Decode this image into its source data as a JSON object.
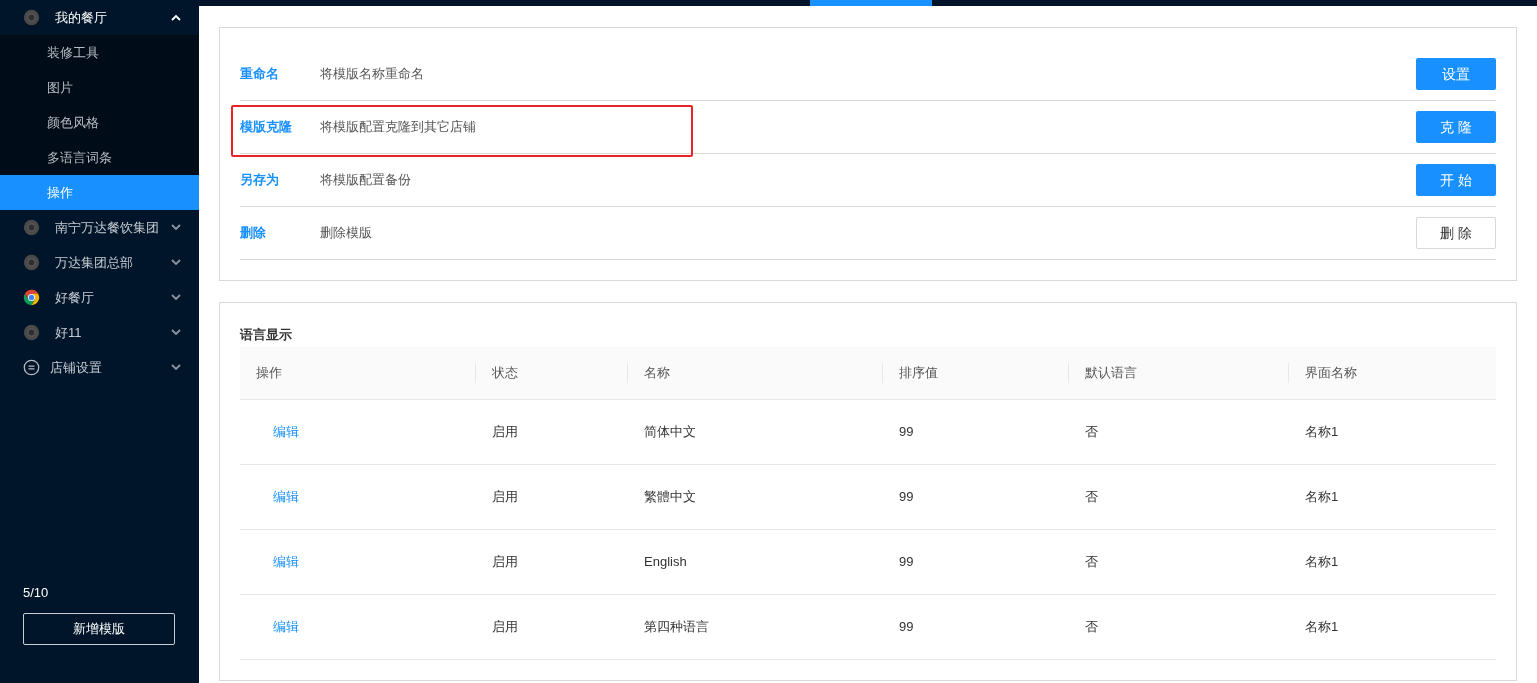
{
  "sidebar": {
    "groups": [
      {
        "label": "我的餐厅",
        "kind": "chrome-grey",
        "expanded": true,
        "children": [
          {
            "label": "装修工具",
            "selected": false
          },
          {
            "label": "图片",
            "selected": false
          },
          {
            "label": "颜色风格",
            "selected": false
          },
          {
            "label": "多语言词条",
            "selected": false
          },
          {
            "label": "操作",
            "selected": true
          }
        ]
      },
      {
        "label": "南宁万达餐饮集团",
        "kind": "chrome-grey",
        "expanded": false
      },
      {
        "label": "万达集团总部",
        "kind": "chrome-grey",
        "expanded": false
      },
      {
        "label": "好餐厅",
        "kind": "chrome-color",
        "expanded": false
      },
      {
        "label": "好11",
        "kind": "chrome-grey",
        "expanded": false
      },
      {
        "label": "店铺设置",
        "kind": "settings",
        "expanded": false
      }
    ],
    "count": "5/10",
    "add_button": "新增模版"
  },
  "operations": [
    {
      "title": "重命名",
      "description": "将模版名称重命名",
      "button": "设置",
      "kind": "primary",
      "highlighted": false
    },
    {
      "title": "模版克隆",
      "description": "将模版配置克隆到其它店铺",
      "button": "克 隆",
      "kind": "primary",
      "highlighted": true
    },
    {
      "title": "另存为",
      "description": "将模版配置备份",
      "button": "开 始",
      "kind": "primary",
      "highlighted": false
    },
    {
      "title": "删除",
      "description": "删除模版",
      "button": "删 除",
      "kind": "default",
      "highlighted": false
    }
  ],
  "language_table": {
    "title": "语言显示",
    "columns": [
      "操作",
      "状态",
      "名称",
      "排序值",
      "默认语言",
      "界面名称"
    ],
    "rows": [
      [
        "编辑",
        "启用",
        "简体中文",
        "99",
        "否",
        "名称1"
      ],
      [
        "编辑",
        "启用",
        "繁體中文",
        "99",
        "否",
        "名称1"
      ],
      [
        "编辑",
        "启用",
        "English",
        "99",
        "否",
        "名称1"
      ],
      [
        "编辑",
        "启用",
        "第四种语言",
        "99",
        "否",
        "名称1"
      ]
    ]
  }
}
